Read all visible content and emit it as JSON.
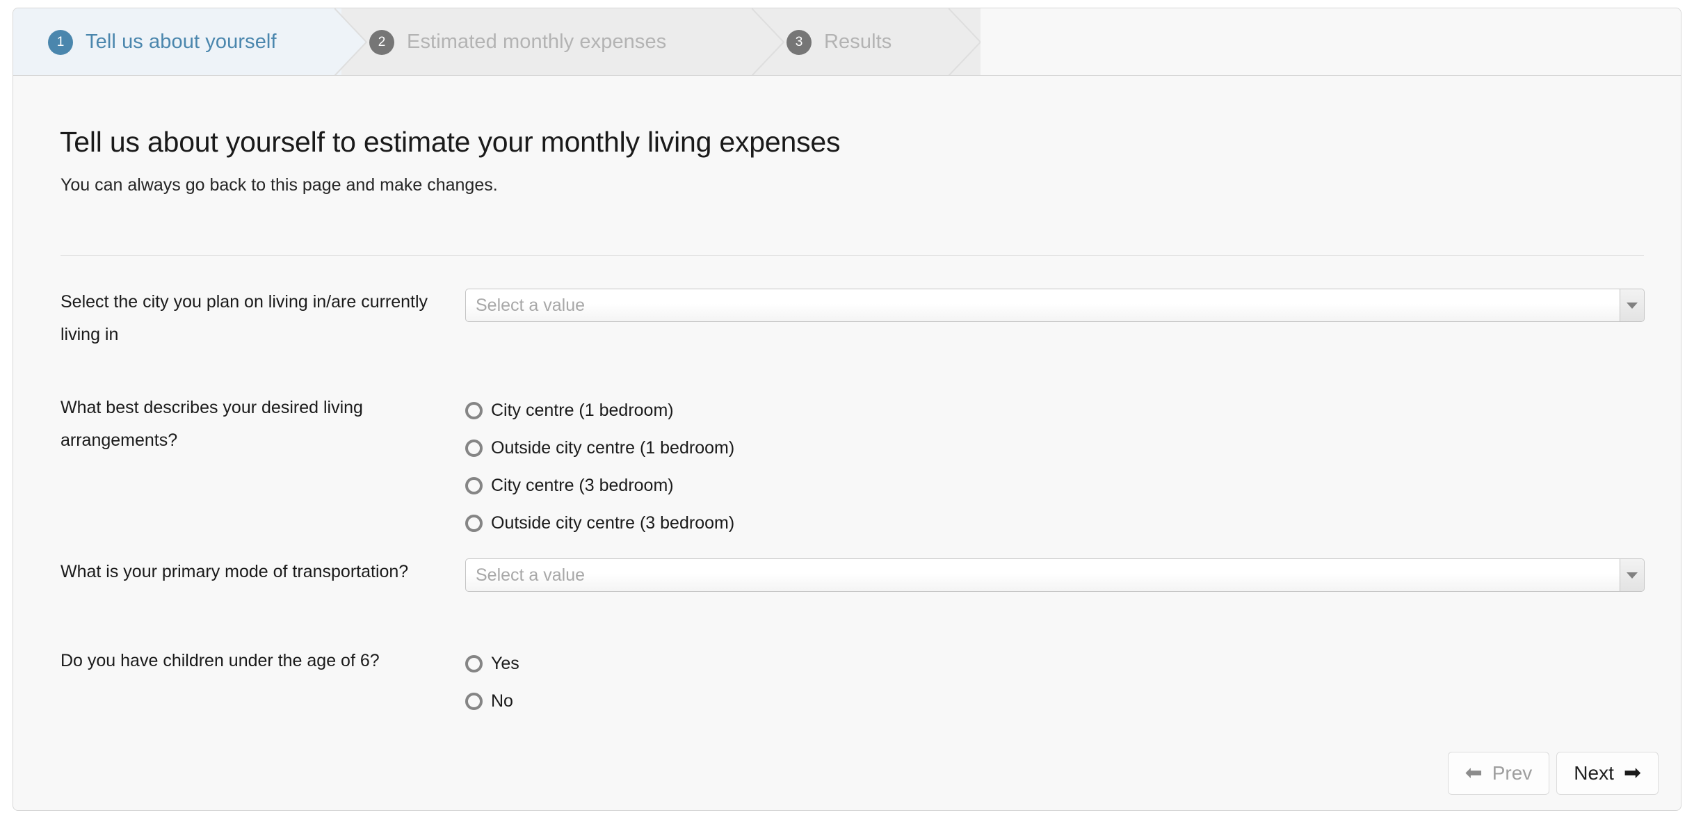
{
  "wizard": {
    "steps": [
      {
        "number": "1",
        "label": "Tell us about yourself",
        "state": "active"
      },
      {
        "number": "2",
        "label": "Estimated monthly expenses",
        "state": "idle"
      },
      {
        "number": "3",
        "label": "Results",
        "state": "idle"
      }
    ],
    "active_color": "#4a86ad",
    "active_bg": "#eef3f8",
    "idle_badge_color": "#767676",
    "idle_label_color": "#b3b3b3"
  },
  "page": {
    "title": "Tell us about yourself to estimate your monthly living expenses",
    "subtitle": "You can always go back to this page and make changes."
  },
  "form": {
    "city": {
      "label": "Select the city you plan on living in/are currently living in",
      "control": "select",
      "value": "",
      "placeholder": "Select a value"
    },
    "living": {
      "label": "What best describes your desired living arrangements?",
      "control": "radio",
      "selected": "",
      "options": [
        "City centre (1 bedroom)",
        "Outside city centre (1 bedroom)",
        "City centre (3 bedroom)",
        "Outside city centre (3 bedroom)"
      ]
    },
    "transport": {
      "label": "What is your primary mode of transportation?",
      "control": "select",
      "value": "",
      "placeholder": "Select a value"
    },
    "children": {
      "label": "Do you have children under the age of 6?",
      "control": "radio",
      "selected": "",
      "options": [
        "Yes",
        "No"
      ]
    }
  },
  "footer": {
    "prev_label": "Prev",
    "next_label": "Next",
    "prev_arrow": "⬅",
    "next_arrow": "➡",
    "prev_enabled": false,
    "next_enabled": true
  }
}
